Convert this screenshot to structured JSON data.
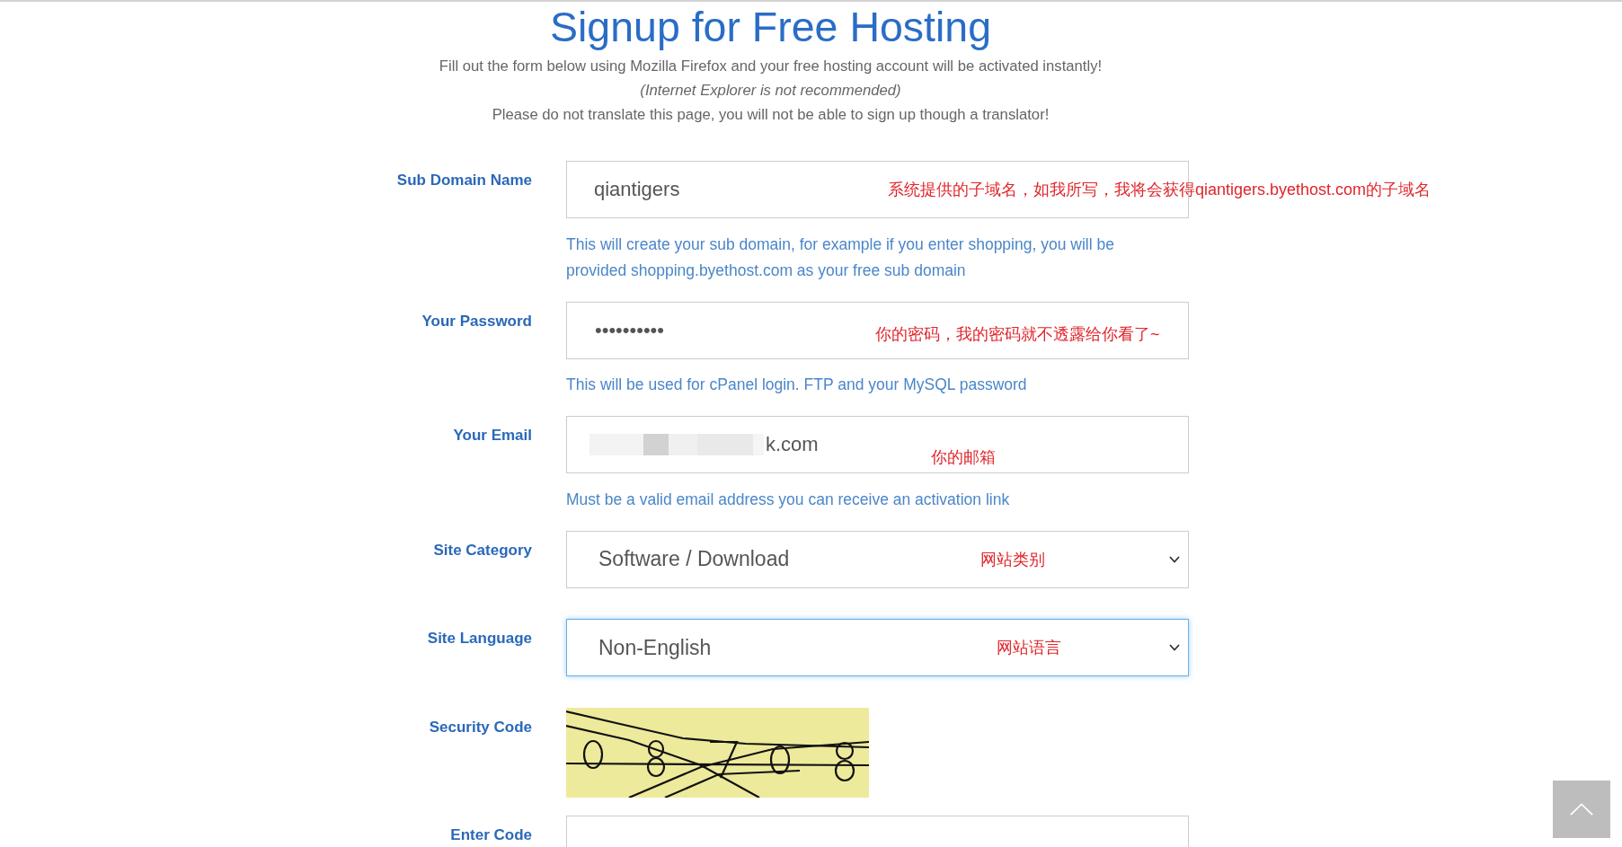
{
  "header": {
    "title": "Signup for Free Hosting",
    "lines": [
      {
        "text": "Fill out the form below using Mozilla Firefox and your free hosting account will be activated instantly!",
        "italic": false
      },
      {
        "text": "(Internet Explorer is not recommended)",
        "italic": true
      },
      {
        "text": "Please do not translate this page, you will not be able to sign up though a translator!",
        "italic": false
      }
    ]
  },
  "form": {
    "rows": [
      {
        "label": "Sub Domain Name",
        "kind": "text",
        "value": "qiantigers",
        "redacted": false,
        "focused": false,
        "annotation": "系统提供的子域名，如我所写，我将会获得qiantigers.byethost.com的子域名",
        "help": "This will create your sub domain, for example if you enter shopping, you will be provided shopping.byethost.com as your free sub domain"
      },
      {
        "label": "Your Password",
        "kind": "password",
        "value": "••••••••••",
        "redacted": false,
        "focused": false,
        "annotation": "你的密码，我的密码就不透露给你看了~",
        "help": "This will be used for cPanel login. FTP and your MySQL password"
      },
      {
        "label": "Your Email",
        "kind": "email",
        "value": "k.com",
        "redacted": true,
        "focused": false,
        "annotation": "你的邮箱",
        "help": "Must be a valid email address you can receive an activation link"
      },
      {
        "label": "Site Category",
        "kind": "select",
        "value": "Software / Download",
        "focused": false,
        "annotation": "网站类别"
      },
      {
        "label": "Site Language",
        "kind": "select",
        "value": "Non-English",
        "focused": true,
        "annotation": "网站语言"
      },
      {
        "label": "Security Code",
        "kind": "captcha",
        "focused": false
      },
      {
        "label": "Enter Code",
        "kind": "text",
        "redacted": false,
        "focused": false
      }
    ]
  }
}
